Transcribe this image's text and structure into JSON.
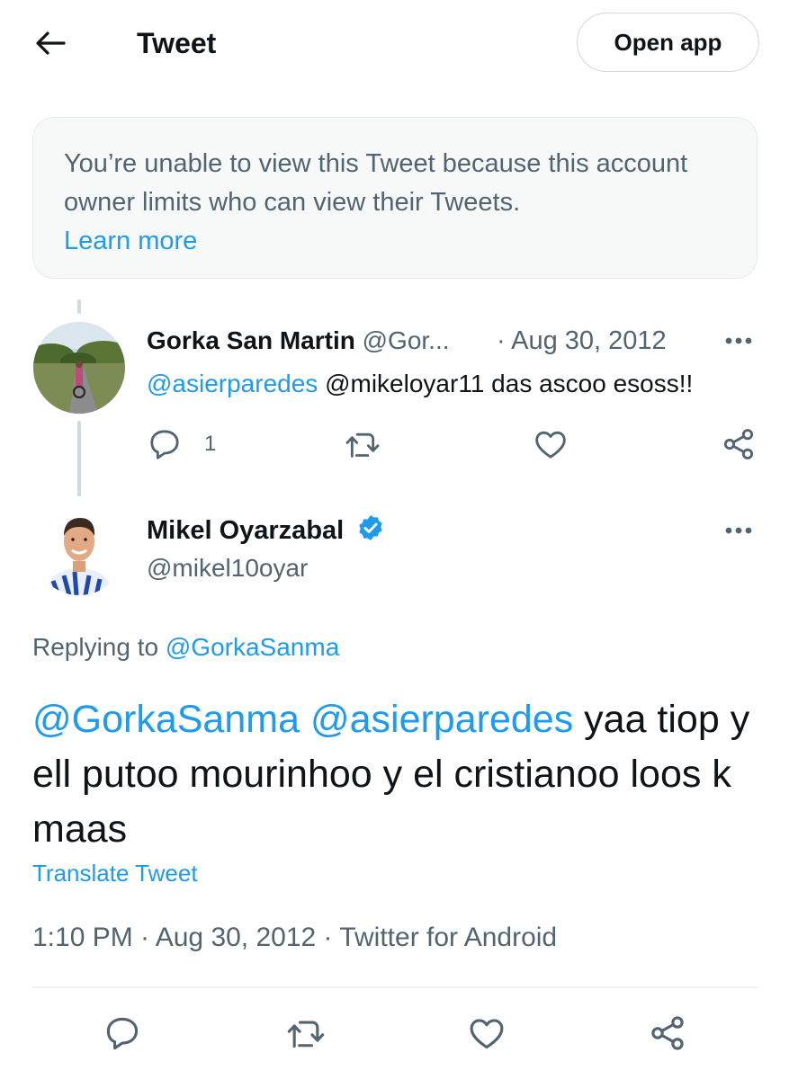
{
  "header": {
    "title": "Tweet",
    "open_app_label": "Open app"
  },
  "notice": {
    "text": "You’re unable to view this Tweet because this account owner limits who can view their Tweets.",
    "learn_more": "Learn more"
  },
  "reply_tweet": {
    "author_name": "Gorka San Martin",
    "author_handle": "@Gor...",
    "date": "· Aug 30, 2012",
    "mention": "@asierparedes",
    "text": " @mikeloyar11 das ascoo esoss!!",
    "reply_count": "1"
  },
  "main_tweet": {
    "author_name": "Mikel Oyarzabal",
    "author_handle": "@mikel10oyar",
    "replying_to_prefix": "Replying to ",
    "replying_to_handle": "@GorkaSanma",
    "mention_1": "@GorkaSanma",
    "mention_2": "@asierparedes",
    "body": " yaa tiop y ell putoo mourinhoo y el cristianoo loos k maas",
    "translate_label": "Translate Tweet",
    "timestamp": "1:10 PM · Aug 30, 2012 · Twitter for Android"
  },
  "colors": {
    "accent": "#1d9bf0",
    "muted": "#536471",
    "text": "#0f1419"
  }
}
